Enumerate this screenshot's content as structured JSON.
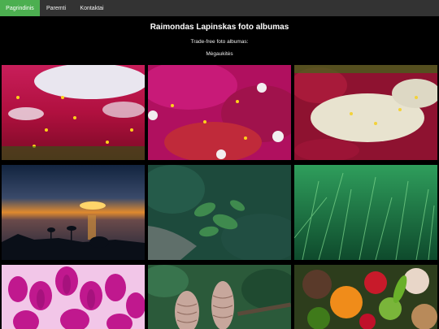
{
  "nav": {
    "items": [
      {
        "label": "Pagrindinis",
        "active": true
      },
      {
        "label": "Paremti",
        "active": false
      },
      {
        "label": "Kontaktai",
        "active": false
      }
    ]
  },
  "header": {
    "title": "Raimondas Lapinskas foto albumas",
    "subtitle": "Trade-free foto albumas:",
    "favorites_link": "Mėgaukitės"
  },
  "colors": {
    "nav_bg": "#333333",
    "nav_active": "#4caf50",
    "page_bg": "#000000"
  }
}
